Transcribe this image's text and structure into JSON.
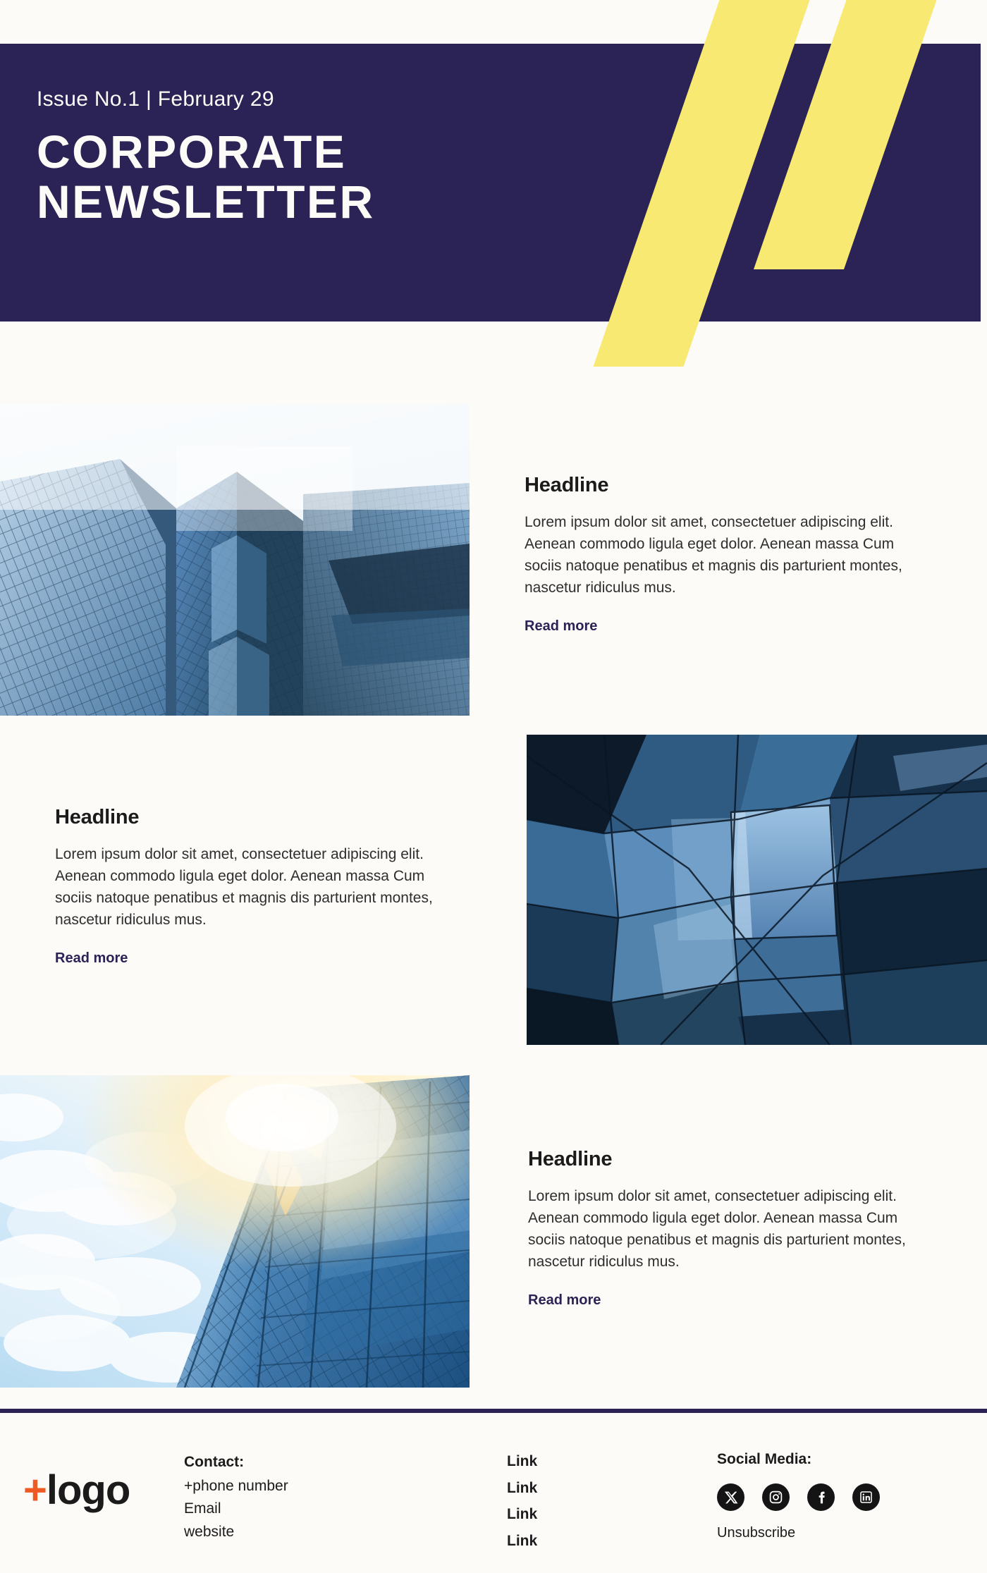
{
  "header": {
    "issue_line": "Issue No.1  |  February 29",
    "title_line_1": "CORPORATE",
    "title_line_2": "NEWSLETTER",
    "bg_color": "#2b2255",
    "accent_color": "#f8e972",
    "text_color": "#fdfbf7"
  },
  "page": {
    "bg_color": "#fdfbf7",
    "link_color": "#2b2255",
    "body_text_color": "#2e2e2e"
  },
  "articles": [
    {
      "headline": "Headline",
      "body": "Lorem ipsum dolor sit amet, consectetuer adipiscing elit. Aenean commodo ligula eget dolor. Aenean massa Cum sociis natoque penatibus et magnis dis parturient montes, nascetur ridiculus mus.",
      "read_more": "Read more",
      "image_alt": "glass-skyscrapers-looking-up",
      "image_side": "left",
      "text_side": "right"
    },
    {
      "headline": "Headline",
      "body": "Lorem ipsum dolor sit amet, consectetuer adipiscing elit. Aenean commodo ligula eget dolor. Aenean massa Cum sociis natoque penatibus et magnis dis parturient montes, nascetur ridiculus mus.",
      "read_more": "Read more",
      "image_alt": "abstract-blue-glass-facets",
      "image_side": "right",
      "text_side": "left"
    },
    {
      "headline": "Headline",
      "body": "Lorem ipsum dolor sit amet, consectetuer adipiscing elit. Aenean commodo ligula eget dolor. Aenean massa Cum sociis natoque penatibus et magnis dis parturient montes, nascetur ridiculus mus.",
      "read_more": "Read more",
      "image_alt": "sunlit-glass-tower-with-clouds",
      "image_side": "left",
      "text_side": "right"
    }
  ],
  "footer": {
    "logo_plus": "+",
    "logo_text": "logo",
    "logo_plus_color": "#ef5a24",
    "contact": {
      "label": "Contact:",
      "phone": "+phone number",
      "email": "Email",
      "website": "website"
    },
    "links": [
      "Link",
      "Link",
      "Link",
      "Link"
    ],
    "social": {
      "label": "Social Media:",
      "icons": [
        "x-icon",
        "instagram-icon",
        "facebook-icon",
        "linkedin-icon"
      ],
      "unsubscribe": "Unsubscribe"
    }
  }
}
